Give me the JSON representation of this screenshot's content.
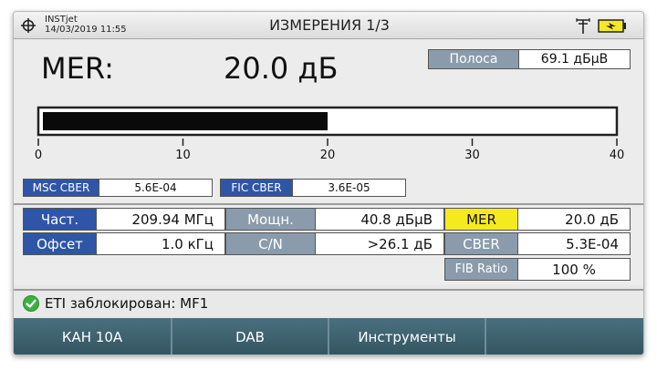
{
  "header": {
    "brand": "INSTjet",
    "datetime": "14/03/2019 11:55",
    "title": "ИЗМЕРЕНИЯ 1/3",
    "left_icon": "crosshair-icon",
    "antenna_icon": "antenna-icon",
    "battery_icon": "battery-charging-icon"
  },
  "main": {
    "mer_label": "MER:",
    "mer_value": "20.0 дБ",
    "polosa": {
      "label": "Полоса",
      "value": "69.1 дБµВ"
    },
    "meter": {
      "value": 20.0,
      "min": 0,
      "max": 40,
      "ticks": [
        "0",
        "10",
        "20",
        "30",
        "40"
      ]
    },
    "msc_cber": {
      "label": "MSC CBER",
      "value": "5.6E-04"
    },
    "fic_cber": {
      "label": "FIC CBER",
      "value": "3.6E-05"
    }
  },
  "params": {
    "freq": {
      "label": "Част.",
      "value": "209.94 МГц"
    },
    "power": {
      "label": "Мощн.",
      "value": "40.8 дБµВ"
    },
    "mer": {
      "label": "MER",
      "value": "20.0 дБ"
    },
    "offset": {
      "label": "Офсет",
      "value": "1.0 кГц"
    },
    "cn": {
      "label": "C/N",
      "value": ">26.1 дБ"
    },
    "cber": {
      "label": "CBER",
      "value": "5.3E-04"
    },
    "fib": {
      "label": "FIB Ratio",
      "value": "100 %"
    }
  },
  "status": {
    "icon": "check-icon",
    "text": "ETI заблокирован: MF1"
  },
  "softkeys": [
    "КАН 10A",
    "DAB",
    "Инструменты",
    ""
  ],
  "colors": {
    "label_blue": "#2f56a6",
    "label_grey": "#8a9bac",
    "label_yellow": "#f5ea1f",
    "softkey_bg": "#3a5f6e",
    "status_ok": "#3cb043"
  }
}
